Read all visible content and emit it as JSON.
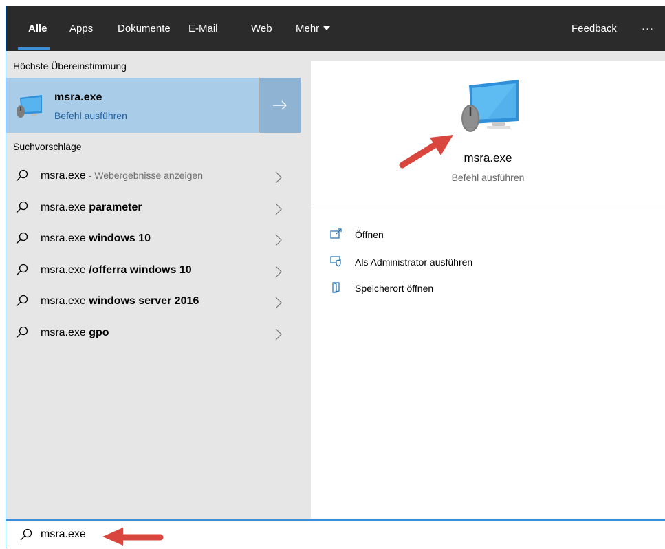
{
  "tabs": [
    {
      "label": "Alle"
    },
    {
      "label": "Apps"
    },
    {
      "label": "Dokumente"
    },
    {
      "label": "E-Mail"
    },
    {
      "label": "Web"
    },
    {
      "label": "Mehr"
    }
  ],
  "topbar": {
    "feedback": "Feedback",
    "more_dots": "···"
  },
  "best_match": {
    "section_label": "Höchste Übereinstimmung",
    "title": "msra.exe",
    "subtitle": "Befehl ausführen",
    "icon": "monitor-mouse-icon"
  },
  "suggestions": {
    "section_label": "Suchvorschläge",
    "items": [
      {
        "prefix": "msra.exe",
        "bold": "",
        "hint": " - Webergebnisse anzeigen"
      },
      {
        "prefix": "msra.exe ",
        "bold": "parameter",
        "hint": ""
      },
      {
        "prefix": "msra.exe ",
        "bold": "windows 10",
        "hint": ""
      },
      {
        "prefix": "msra.exe ",
        "bold": "/offerra windows 10",
        "hint": ""
      },
      {
        "prefix": "msra.exe ",
        "bold": "windows server 2016",
        "hint": ""
      },
      {
        "prefix": "msra.exe ",
        "bold": "gpo",
        "hint": ""
      }
    ]
  },
  "detail": {
    "title": "msra.exe",
    "subtitle": "Befehl ausführen",
    "actions": [
      {
        "label": "Öffnen",
        "icon": "open-icon"
      },
      {
        "label": "Als Administrator ausführen",
        "icon": "admin-shield-icon"
      },
      {
        "label": "Speicherort öffnen",
        "icon": "file-location-icon"
      }
    ]
  },
  "search": {
    "value": "msra.exe"
  },
  "colors": {
    "accent": "#3b8fd9",
    "selection": "#a9cde8",
    "annotation_arrow": "#d9463e"
  }
}
